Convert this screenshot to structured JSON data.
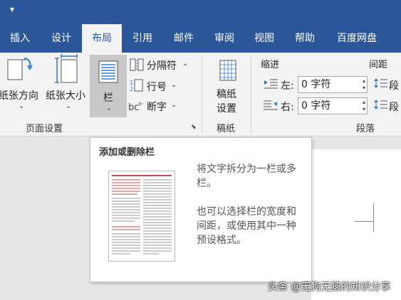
{
  "qat": {
    "glyph": "▾"
  },
  "tabs": [
    {
      "label": "插入"
    },
    {
      "label": "设计"
    },
    {
      "label": "布局",
      "active": true
    },
    {
      "label": "引用"
    },
    {
      "label": "邮件"
    },
    {
      "label": "审阅"
    },
    {
      "label": "视图"
    },
    {
      "label": "帮助"
    },
    {
      "label": "百度网盘"
    }
  ],
  "ribbon": {
    "orientation_label": "纸张方向",
    "size_label": "纸张大小",
    "columns_label": "栏",
    "breaks_label": "分隔符",
    "line_numbers_label": "行号",
    "hyphenation_label": "断字",
    "page_setup_group": "页面设置",
    "draft_btn_line1": "稿纸",
    "draft_btn_line2": "设置",
    "draft_group": "稿纸",
    "indent_header": "缩进",
    "spacing_header": "间距",
    "indent_left_label": "左:",
    "indent_left_value": "0 字符",
    "indent_right_label": "右:",
    "indent_right_value": "0 字符",
    "spacing_before_label": "段",
    "spacing_after_label": "段",
    "paragraph_group": "段落"
  },
  "tooltip": {
    "title": "添加或删除栏",
    "text1_line1": "将文字拆分为一栏或多",
    "text1_line2": "栏。",
    "text2_line1": "也可以选择栏的宽度和",
    "text2_line2": "间距，或使用其中一种",
    "text2_line3": "预设格式。"
  },
  "watermark": "头条 @无狗无猿的知识分享",
  "colors": {
    "accent": "#2b579a",
    "ribbon_bg": "#f3f3f3",
    "selected_btn": "#c8c8c8"
  }
}
